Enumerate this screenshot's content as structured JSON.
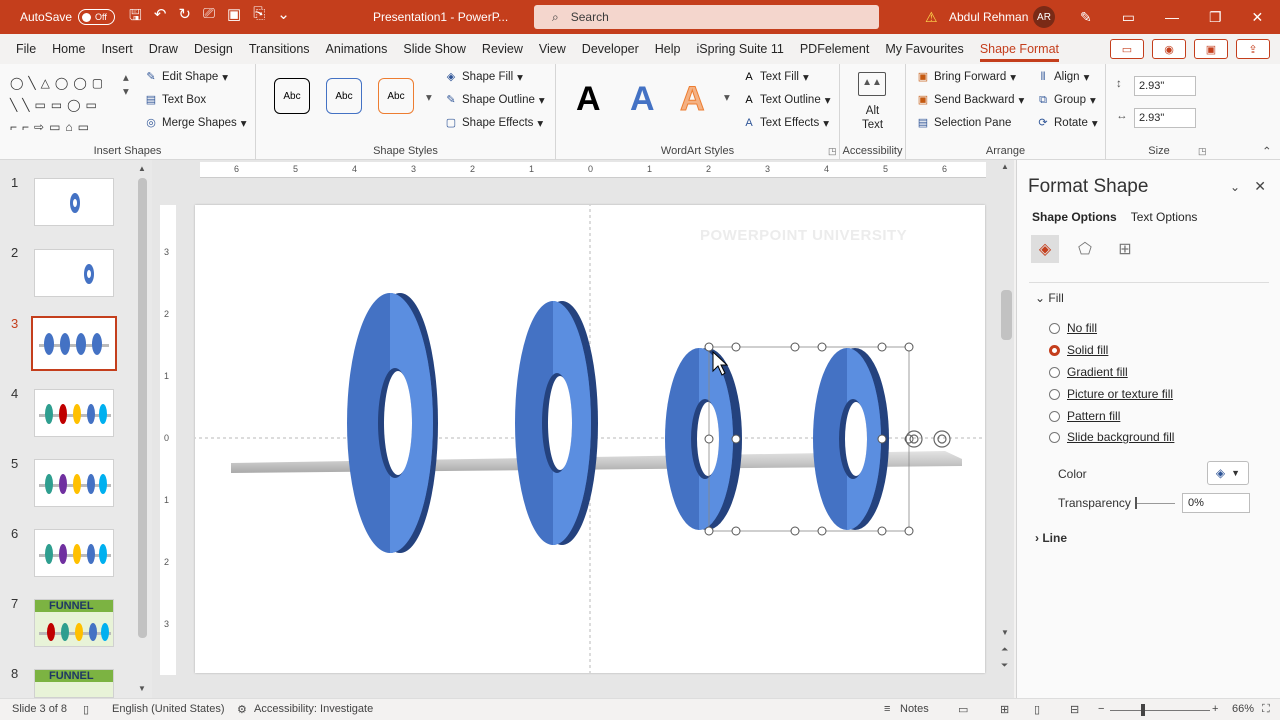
{
  "titlebar": {
    "autosave_label": "AutoSave",
    "autosave_state": "Off",
    "doc_title": "Presentation1 - PowerP...",
    "search_placeholder": "Search",
    "user_name": "Abdul Rehman",
    "user_initials": "AR"
  },
  "menu": {
    "tabs": [
      "File",
      "Home",
      "Insert",
      "Draw",
      "Design",
      "Transitions",
      "Animations",
      "Slide Show",
      "Review",
      "View",
      "Developer",
      "Help",
      "iSpring Suite 11",
      "PDFelement",
      "My Favourites",
      "Shape Format"
    ],
    "active_tab": "Shape Format"
  },
  "ribbon": {
    "insert_shapes": {
      "label": "Insert Shapes",
      "edit_shape": "Edit Shape",
      "text_box": "Text Box",
      "merge_shapes": "Merge Shapes"
    },
    "shape_styles": {
      "label": "Shape Styles",
      "preset": "Abc",
      "shape_fill": "Shape Fill",
      "shape_outline": "Shape Outline",
      "shape_effects": "Shape Effects"
    },
    "wordart": {
      "label": "WordArt Styles",
      "preset": "A",
      "text_fill": "Text Fill",
      "text_outline": "Text Outline",
      "text_effects": "Text Effects"
    },
    "accessibility": {
      "label": "Accessibility",
      "alt_text_line1": "Alt",
      "alt_text_line2": "Text"
    },
    "arrange": {
      "label": "Arrange",
      "bring_forward": "Bring Forward",
      "send_backward": "Send Backward",
      "selection_pane": "Selection Pane",
      "align": "Align",
      "group": "Group",
      "rotate": "Rotate"
    },
    "size": {
      "label": "Size",
      "height": "2.93\"",
      "width": "2.93\""
    }
  },
  "thumbnails": {
    "numbers": [
      "1",
      "2",
      "3",
      "4",
      "5",
      "6",
      "7",
      "8"
    ],
    "active": "3",
    "funnel_text": "FUNNEL"
  },
  "ruler": {
    "h_ticks": [
      "6",
      "5",
      "4",
      "3",
      "2",
      "1",
      "0",
      "1",
      "2",
      "3",
      "4",
      "5",
      "6"
    ],
    "v_ticks": [
      "3",
      "2",
      "1",
      "0",
      "1",
      "2",
      "3"
    ]
  },
  "slide": {
    "watermark": "POWERPOINT UNIVERSITY",
    "colors": {
      "ring_main": "#4472c4",
      "ring_light": "#5b8ee0",
      "ring_dark": "#24427e",
      "bar": "#c8c8c8"
    }
  },
  "format_pane": {
    "title": "Format Shape",
    "tab_shape_options": "Shape Options",
    "tab_text_options": "Text Options",
    "fill_section": "Fill",
    "fill_options": [
      "No fill",
      "Solid fill",
      "Gradient fill",
      "Picture or texture fill",
      "Pattern fill",
      "Slide background fill"
    ],
    "selected_fill": "Solid fill",
    "color_label": "Color",
    "transparency_label": "Transparency",
    "transparency_value": "0%",
    "line_section": "Line"
  },
  "statusbar": {
    "slide_info": "Slide 3 of 8",
    "language": "English (United States)",
    "accessibility": "Accessibility: Investigate",
    "notes": "Notes",
    "zoom": "66%"
  }
}
